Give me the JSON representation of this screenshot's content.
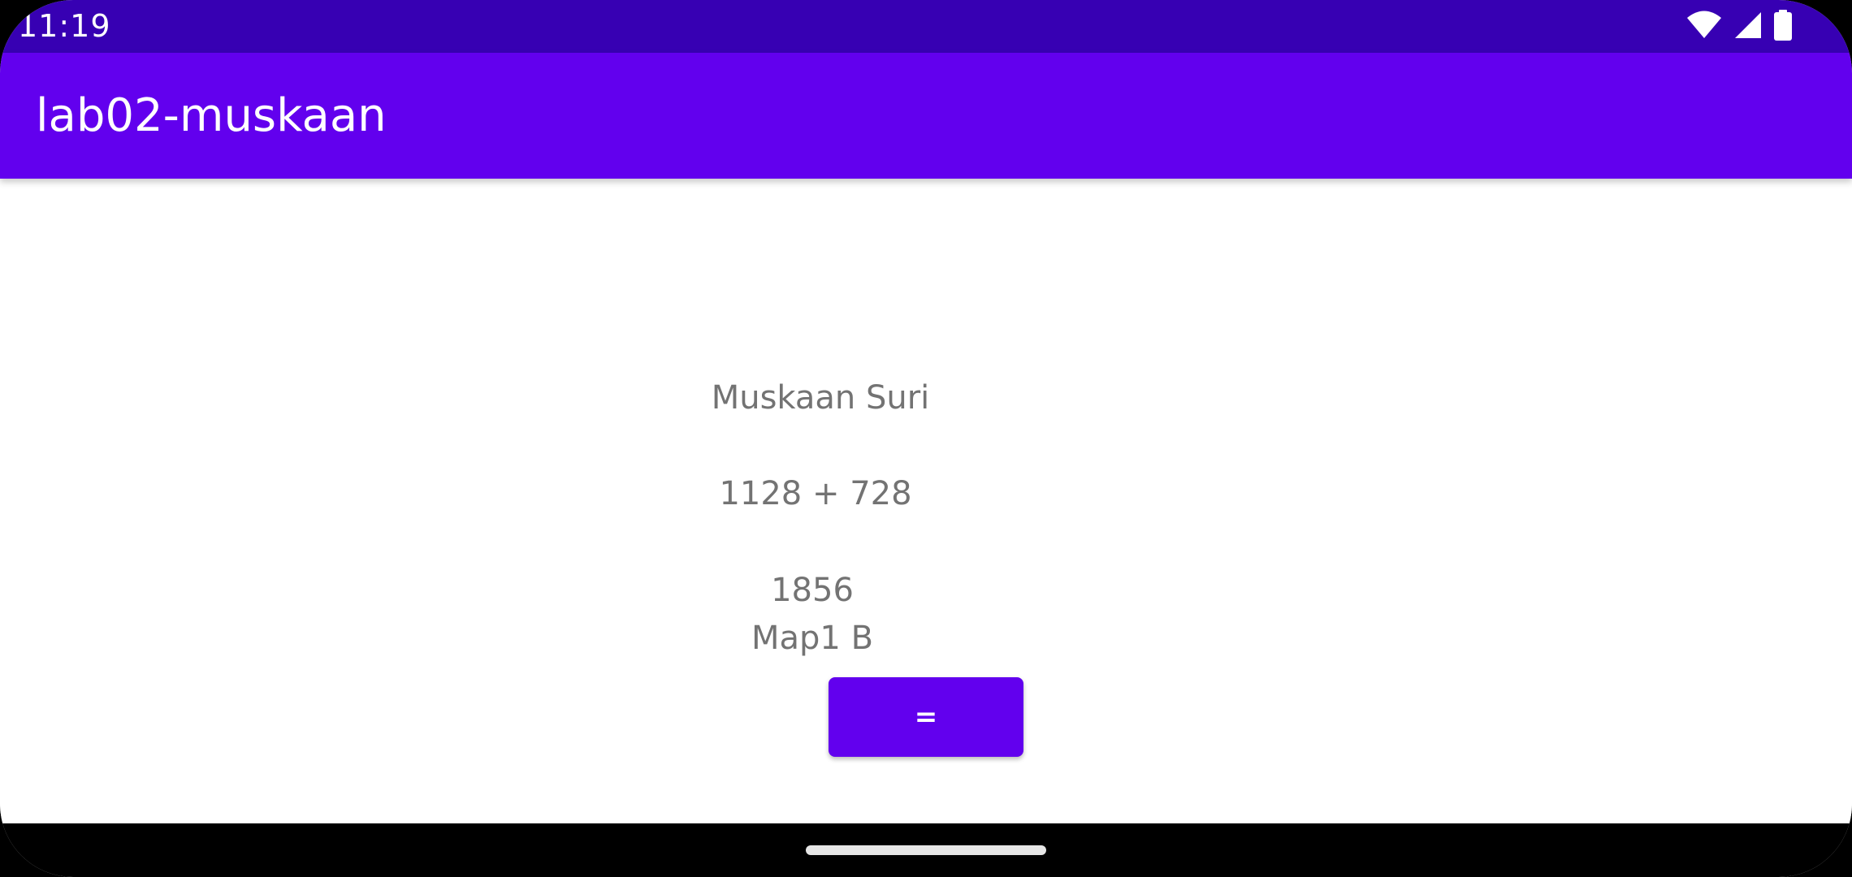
{
  "status_bar": {
    "time": "11:19",
    "icons": [
      "wifi-icon",
      "cell-signal-icon",
      "battery-icon"
    ]
  },
  "app_bar": {
    "title": "lab02-muskaan"
  },
  "main": {
    "name_label": "Muskaan Suri",
    "expression_label": "1128 + 728",
    "result_label": "1856",
    "map_label": "Map1 B",
    "equals_button_label": "="
  },
  "colors": {
    "status_bar": "#3700b3",
    "app_bar": "#6200ee",
    "button": "#6200ee",
    "label_text": "#737373"
  }
}
